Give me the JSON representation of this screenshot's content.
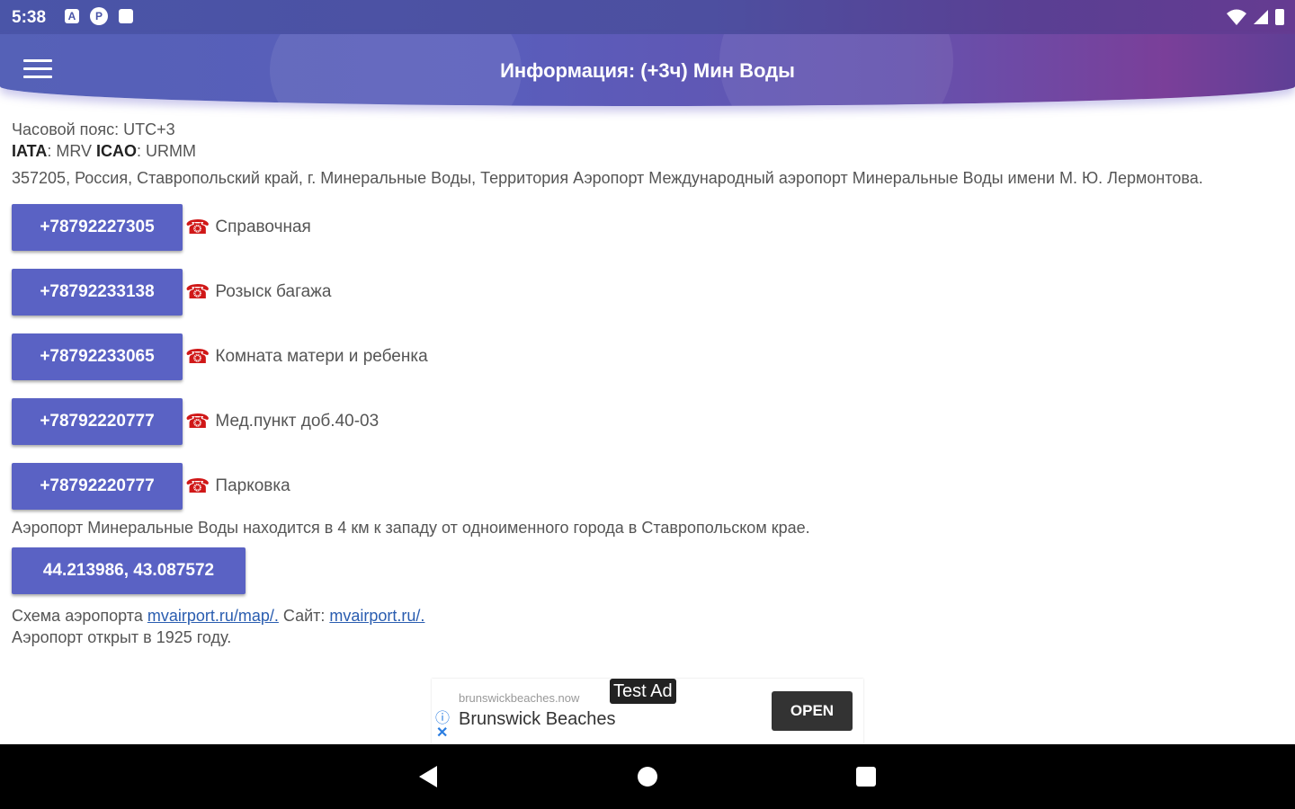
{
  "status_bar": {
    "time": "5:38"
  },
  "app_bar": {
    "title": "Информация: (+3ч) Мин Воды"
  },
  "info": {
    "timezone": "Часовой пояс: UTC+3",
    "iata_label": "IATA",
    "iata_value": ": MRV ",
    "icao_label": "ICAO",
    "icao_value": ": URMM",
    "address": "357205, Россия, Ставропольский край, г. Минеральные Воды, Территория Аэропорт Международный аэропорт Минеральные Воды имени М. Ю. Лермонтова."
  },
  "phones": [
    {
      "number": "+78792227305",
      "label": "Справочная"
    },
    {
      "number": "+78792233138",
      "label": "Розыск багажа"
    },
    {
      "number": "+78792233065",
      "label": "Комната матери и ребенка"
    },
    {
      "number": "+78792220777",
      "label": "Мед.пункт доб.40-03"
    },
    {
      "number": "+78792220777",
      "label": "Парковка"
    }
  ],
  "description": "Аэропорт Минеральные Воды находится в 4 км к западу от одноименного города в Ставропольском крае.",
  "coordinates": "44.213986, 43.087572",
  "links": {
    "scheme_label": "Схема аэропорта ",
    "scheme_link": "mvairport.ru/map/.",
    "site_label": " Сайт: ",
    "site_link": "mvairport.ru/.",
    "opened": "Аэропорт открыт в 1925 году."
  },
  "ad": {
    "domain": "brunswickbeaches.now",
    "badge": "Test Ad",
    "title": "Brunswick Beaches",
    "open_label": "OPEN"
  },
  "colors": {
    "accent": "#5a62c4",
    "phone_icon": "#d01818",
    "link": "#2a5db0"
  },
  "icons": {
    "menu": "hamburger-icon",
    "phone": "telephone-icon"
  }
}
